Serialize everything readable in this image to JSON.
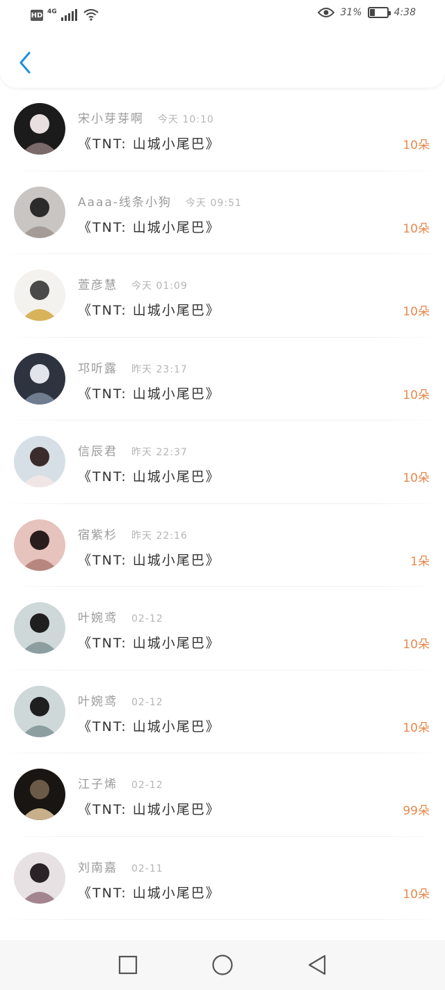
{
  "status_bar": {
    "hd": "HD",
    "network": "4G",
    "battery_percent": "31%",
    "time": "4:38",
    "battery_level": 0.31,
    "icons": [
      "signal-icon",
      "wifi-icon",
      "eye-icon",
      "battery-icon"
    ]
  },
  "header": {
    "back_icon": "chevron-left-icon",
    "accent_color": "#1f8fe0"
  },
  "list": {
    "amount_color": "#e5894e",
    "items": [
      {
        "name": "宋小芽芽啊",
        "time": "今天 10:10",
        "title": "《TNT: 山城小尾巴》",
        "amount": "10朵"
      },
      {
        "name": "Aaaa-线条小狗",
        "time": "今天 09:51",
        "title": "《TNT: 山城小尾巴》",
        "amount": "10朵"
      },
      {
        "name": "萱彦慧",
        "time": "今天 01:09",
        "title": "《TNT: 山城小尾巴》",
        "amount": "10朵"
      },
      {
        "name": "邛听露",
        "time": "昨天 23:17",
        "title": "《TNT: 山城小尾巴》",
        "amount": "10朵"
      },
      {
        "name": "信辰君",
        "time": "昨天 22:37",
        "title": "《TNT: 山城小尾巴》",
        "amount": "10朵"
      },
      {
        "name": "宿紫杉",
        "time": "昨天 22:16",
        "title": "《TNT: 山城小尾巴》",
        "amount": "1朵"
      },
      {
        "name": "叶婉鸢",
        "time": "02-12",
        "title": "《TNT: 山城小尾巴》",
        "amount": "10朵"
      },
      {
        "name": "叶婉鸢",
        "time": "02-12",
        "title": "《TNT: 山城小尾巴》",
        "amount": "10朵"
      },
      {
        "name": "江子烯",
        "time": "02-12",
        "title": "《TNT: 山城小尾巴》",
        "amount": "99朵"
      },
      {
        "name": "刘南嘉",
        "time": "02-11",
        "title": "《TNT: 山城小尾巴》",
        "amount": "10朵"
      }
    ]
  },
  "nav_bar": {
    "icons": [
      "recent-apps-icon",
      "home-icon",
      "back-triangle-icon"
    ]
  }
}
